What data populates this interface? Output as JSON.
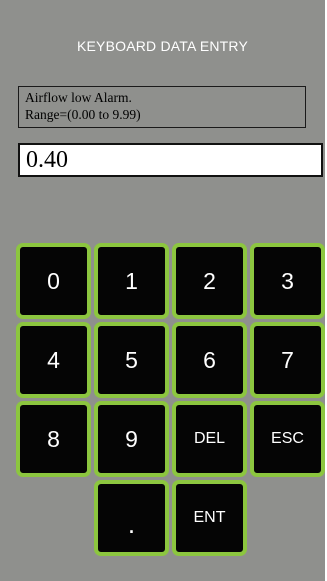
{
  "dialog": {
    "title": "KEYBOARD DATA ENTRY",
    "prompt_line1": "Airflow low Alarm.",
    "prompt_line2": "Range=(0.00 to 9.99)",
    "value": "0.40"
  },
  "keypad": {
    "k0": "0",
    "k1": "1",
    "k2": "2",
    "k3": "3",
    "k4": "4",
    "k5": "5",
    "k6": "6",
    "k7": "7",
    "k8": "8",
    "k9": "9",
    "del": "DEL",
    "esc": "ESC",
    "dot": ".",
    "ent": "ENT"
  },
  "colors": {
    "panel_bg": "#8f908d",
    "key_bg": "#050505",
    "key_border": "#8cc63f"
  }
}
